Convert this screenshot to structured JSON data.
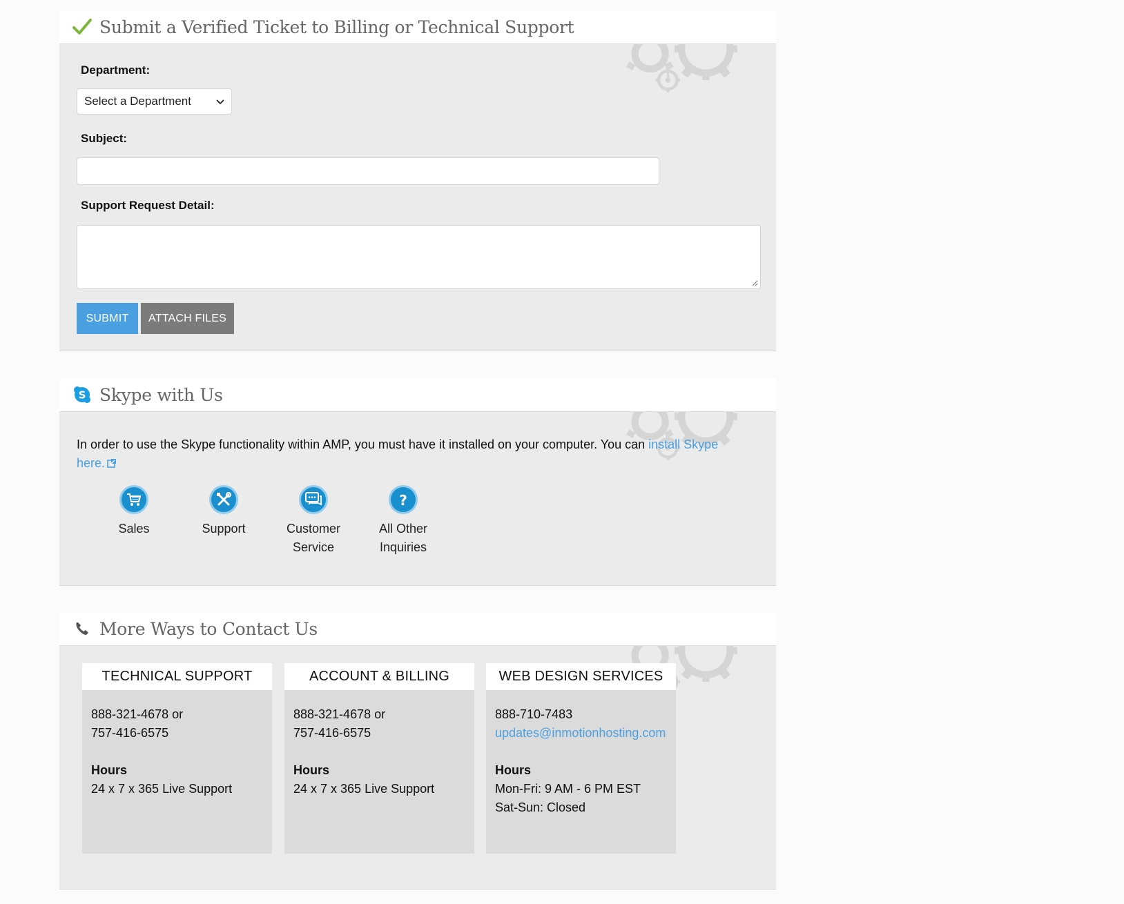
{
  "ticket_panel": {
    "title": "Submit a Verified Ticket to Billing or Technical Support",
    "icon": "checkmark-icon",
    "department_label": "Department:",
    "department_select_value": "Select a Department",
    "subject_label": "Subject:",
    "subject_value": "",
    "detail_label": "Support Request Detail:",
    "detail_value": "",
    "submit_label": "SUBMIT",
    "attach_label": "ATTACH FILES"
  },
  "skype_panel": {
    "title": "Skype with Us",
    "icon": "skype-icon",
    "intro_text": "In order to use the Skype functionality within AMP, you must have it installed on your computer. You can ",
    "install_link_text": "install Skype here.",
    "options": [
      {
        "label_line1": "Sales",
        "label_line2": "",
        "icon": "shopping-cart-icon"
      },
      {
        "label_line1": "Support",
        "label_line2": "",
        "icon": "wrench-screwdriver-icon"
      },
      {
        "label_line1": "Customer",
        "label_line2": "Service",
        "icon": "chat-bubbles-icon"
      },
      {
        "label_line1": "All Other",
        "label_line2": "Inquiries",
        "icon": "question-mark-icon"
      }
    ]
  },
  "contact_panel": {
    "title": "More Ways to Contact Us",
    "icon": "phone-icon",
    "cards": [
      {
        "heading": "TECHNICAL SUPPORT",
        "phone_line1": "888-321-4678 or",
        "phone_line2": "757-416-6575",
        "hours_label": "Hours",
        "hours_line1": "24 x 7 x 365 Live Support",
        "hours_line2": ""
      },
      {
        "heading": "ACCOUNT & BILLING",
        "phone_line1": "888-321-4678 or",
        "phone_line2": "757-416-6575",
        "hours_label": "Hours",
        "hours_line1": "24 x 7 x 365 Live Support",
        "hours_line2": ""
      },
      {
        "heading": "WEB DESIGN SERVICES",
        "phone_line1": "888-710-7483",
        "email": "updates@inmotionhosting.com",
        "hours_label": "Hours",
        "hours_line1": "Mon-Fri: 9 AM - 6 PM EST",
        "hours_line2": "Sat-Sun: Closed"
      }
    ]
  },
  "colors": {
    "accent_blue": "#4a9fe0",
    "attach_gray": "#7b7b7b",
    "check_green": "#7cb63b",
    "skype_blue": "#1a8fce"
  }
}
